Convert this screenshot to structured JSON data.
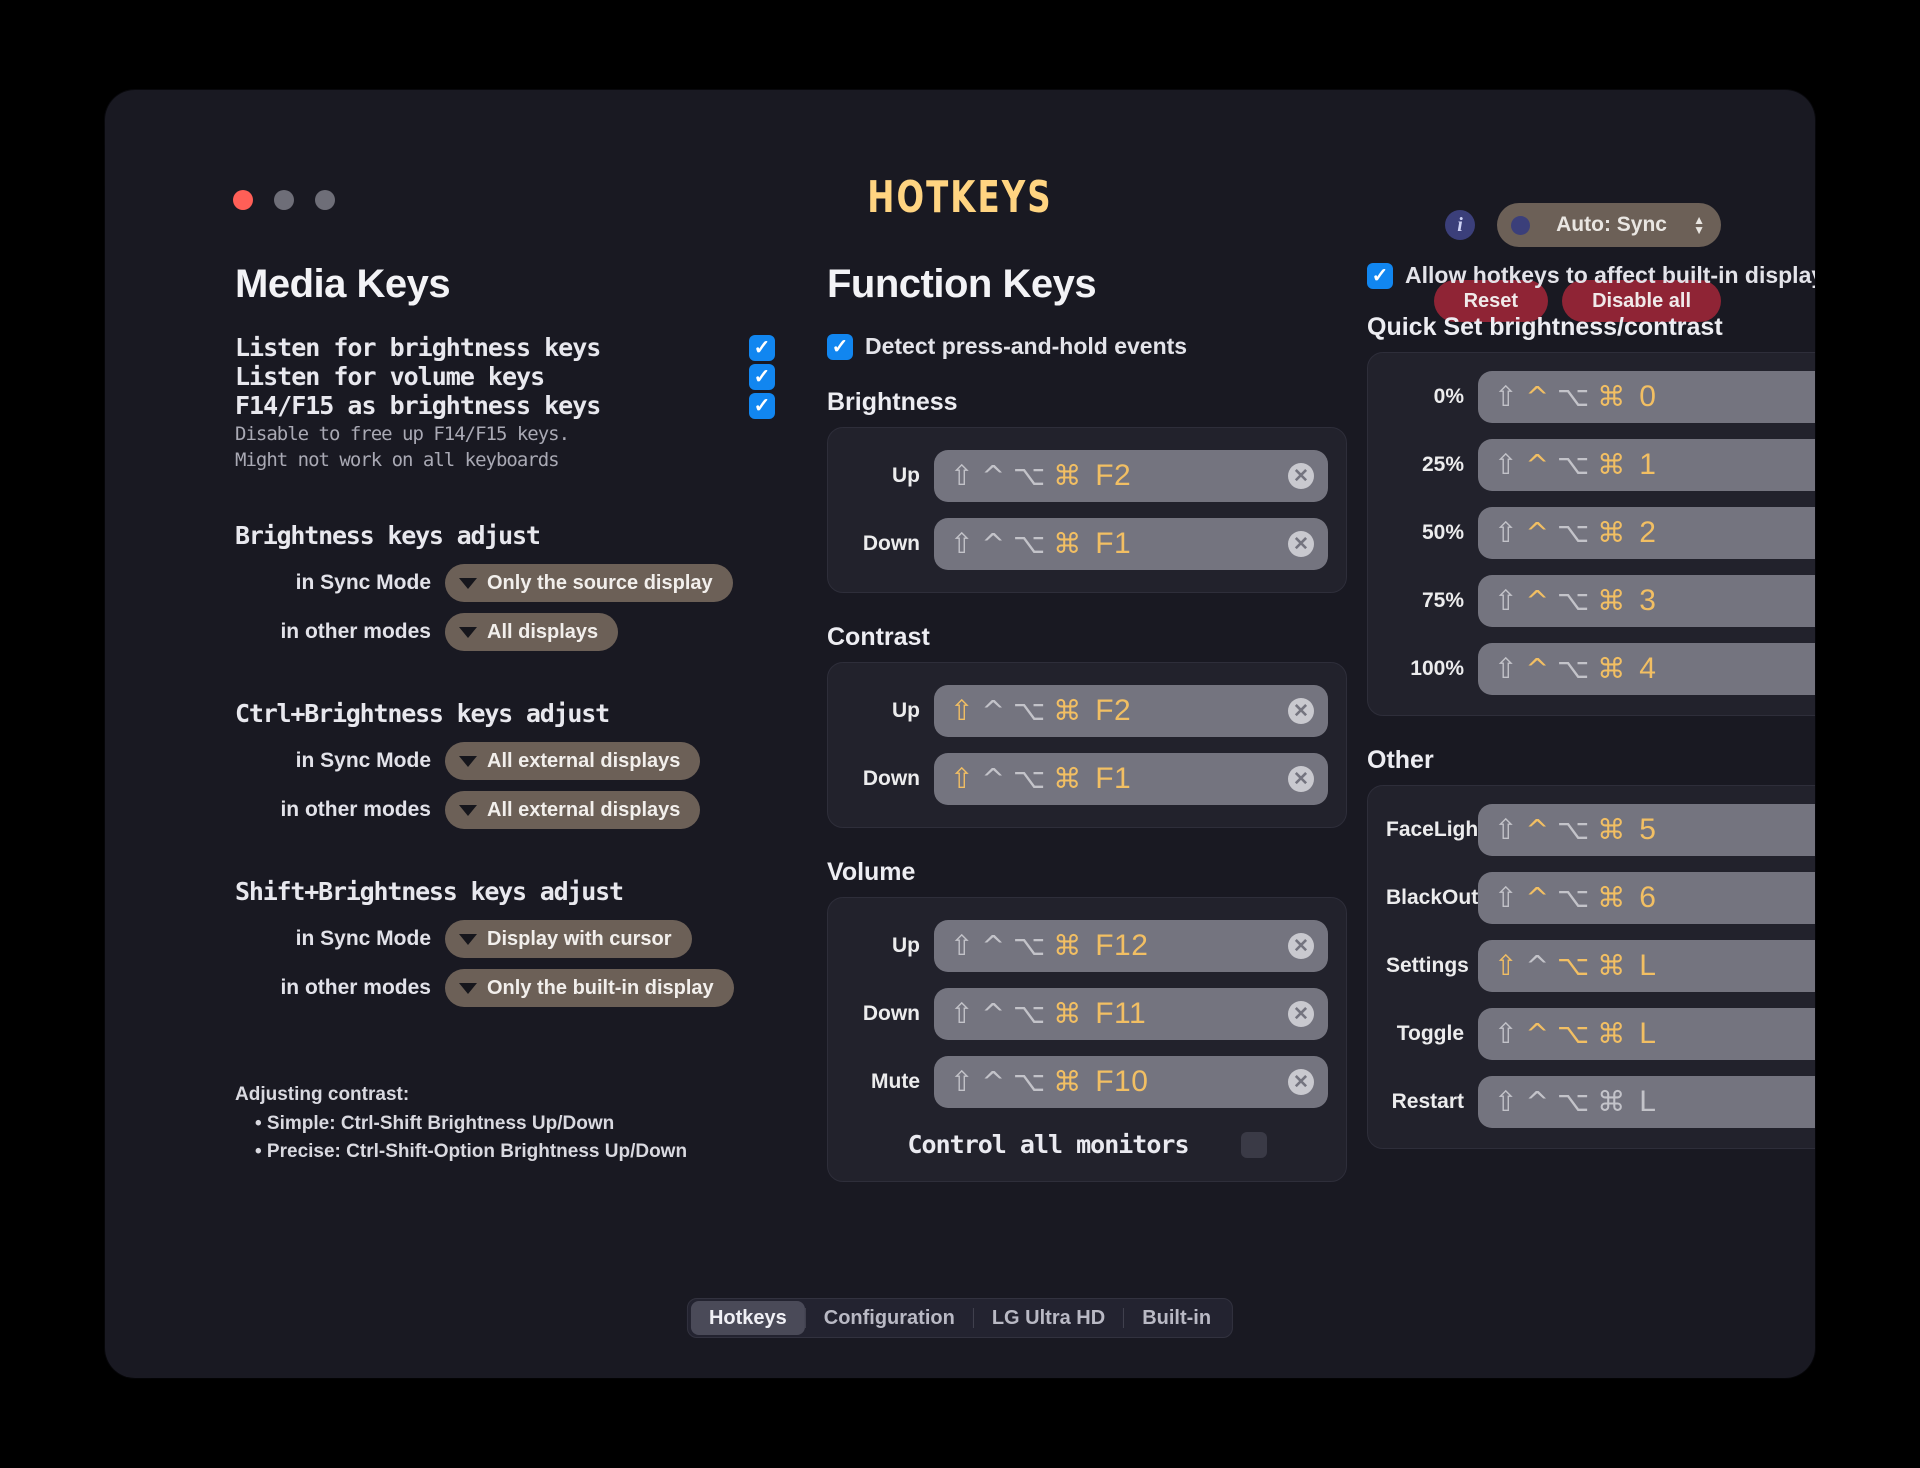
{
  "window": {
    "title": "HOTKEYS",
    "traffic_lights": [
      "close",
      "minimize",
      "zoom"
    ]
  },
  "topbar": {
    "info_icon": "info-icon",
    "mode_selector": {
      "label": "Auto: Sync"
    },
    "reset_label": "Reset",
    "disable_all_label": "Disable all"
  },
  "media_keys": {
    "heading": "Media Keys",
    "toggles": [
      {
        "label": "Listen for brightness keys",
        "checked": true
      },
      {
        "label": "Listen for volume keys",
        "checked": true
      },
      {
        "label": "F14/F15 as brightness keys",
        "checked": true,
        "sub": "Disable to free up F14/F15 keys.\nMight not work on all keyboards"
      }
    ],
    "adjust_groups": [
      {
        "title": "Brightness keys adjust",
        "rows": [
          {
            "mode": "in Sync Mode",
            "value": "Only the source display"
          },
          {
            "mode": "in other modes",
            "value": "All displays"
          }
        ]
      },
      {
        "title": "Ctrl+Brightness keys adjust",
        "rows": [
          {
            "mode": "in Sync Mode",
            "value": "All external displays"
          },
          {
            "mode": "in other modes",
            "value": "All external displays"
          }
        ]
      },
      {
        "title": "Shift+Brightness keys adjust",
        "rows": [
          {
            "mode": "in Sync Mode",
            "value": "Display with cursor"
          },
          {
            "mode": "in other modes",
            "value": "Only the built-in display"
          }
        ]
      }
    ],
    "footnote": {
      "title": "Adjusting contrast:",
      "line1": "• Simple:  Ctrl-Shift Brightness Up/Down",
      "line2": "• Precise: Ctrl-Shift-Option Brightness Up/Down"
    }
  },
  "function_keys": {
    "heading": "Function Keys",
    "detect": {
      "label": "Detect press-and-hold events",
      "checked": true
    },
    "groups": [
      {
        "title": "Brightness",
        "rows": [
          {
            "name": "Up",
            "shift": false,
            "ctrl": false,
            "opt": false,
            "cmd": true,
            "key": "F2"
          },
          {
            "name": "Down",
            "shift": false,
            "ctrl": false,
            "opt": false,
            "cmd": true,
            "key": "F1"
          }
        ]
      },
      {
        "title": "Contrast",
        "rows": [
          {
            "name": "Up",
            "shift": true,
            "ctrl": false,
            "opt": false,
            "cmd": true,
            "key": "F2"
          },
          {
            "name": "Down",
            "shift": true,
            "ctrl": false,
            "opt": false,
            "cmd": true,
            "key": "F1"
          }
        ]
      },
      {
        "title": "Volume",
        "rows": [
          {
            "name": "Up",
            "shift": false,
            "ctrl": false,
            "opt": false,
            "cmd": true,
            "key": "F12"
          },
          {
            "name": "Down",
            "shift": false,
            "ctrl": false,
            "opt": false,
            "cmd": true,
            "key": "F11"
          },
          {
            "name": "Mute",
            "shift": false,
            "ctrl": false,
            "opt": false,
            "cmd": true,
            "key": "F10"
          }
        ],
        "extra_toggle": {
          "label": "Control all monitors",
          "checked": false
        }
      }
    ]
  },
  "right_panel": {
    "allow_builtin": {
      "label": "Allow hotkeys to affect built-in display",
      "checked": true
    },
    "quick_set": {
      "title": "Quick Set brightness/contrast",
      "rows": [
        {
          "name": "0%",
          "shift": false,
          "ctrl": true,
          "opt": false,
          "cmd": true,
          "key": "0"
        },
        {
          "name": "25%",
          "shift": false,
          "ctrl": true,
          "opt": false,
          "cmd": true,
          "key": "1"
        },
        {
          "name": "50%",
          "shift": false,
          "ctrl": true,
          "opt": false,
          "cmd": true,
          "key": "2"
        },
        {
          "name": "75%",
          "shift": false,
          "ctrl": true,
          "opt": false,
          "cmd": true,
          "key": "3"
        },
        {
          "name": "100%",
          "shift": false,
          "ctrl": true,
          "opt": false,
          "cmd": true,
          "key": "4"
        }
      ]
    },
    "other": {
      "title": "Other",
      "rows": [
        {
          "name": "FaceLight",
          "shift": false,
          "ctrl": true,
          "opt": false,
          "cmd": true,
          "key": "5"
        },
        {
          "name": "BlackOut",
          "shift": false,
          "ctrl": true,
          "opt": false,
          "cmd": true,
          "key": "6"
        },
        {
          "name": "Settings",
          "shift": true,
          "ctrl": false,
          "opt": true,
          "cmd": true,
          "key": "L"
        },
        {
          "name": "Toggle",
          "shift": false,
          "ctrl": true,
          "opt": true,
          "cmd": true,
          "key": "L"
        },
        {
          "name": "Restart",
          "shift": false,
          "ctrl": false,
          "opt": false,
          "cmd": false,
          "key": "L"
        }
      ]
    }
  },
  "tabs": [
    {
      "label": "Hotkeys",
      "active": true
    },
    {
      "label": "Configuration",
      "active": false
    },
    {
      "label": "LG Ultra HD",
      "active": false
    },
    {
      "label": "Built-in",
      "active": false
    }
  ],
  "glyphs": {
    "shift": "⇧",
    "ctrl": "^",
    "option": "⌥",
    "command": "⌘",
    "check": "✓",
    "clear": "✕",
    "caret_up": "⌃",
    "caret_down": "⌄"
  },
  "colors": {
    "accent_gold": "#f2bf63",
    "checkbox_blue": "#1186f0",
    "danger_red": "#8f2435",
    "pill_brown": "#6c6057"
  }
}
